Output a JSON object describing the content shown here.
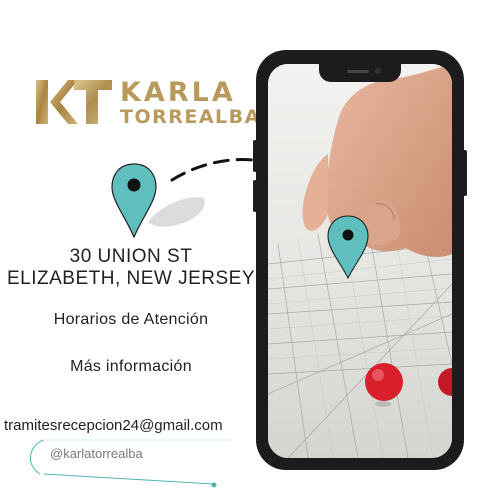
{
  "brand": {
    "line1": "KARLA",
    "line2": "TORREALBA",
    "monogram": "KT-monogram",
    "color": "#b89a5c"
  },
  "address": {
    "line1": "30 UNION ST",
    "line2": "ELIZABETH, NEW JERSEY"
  },
  "links": {
    "hours": "Horarios de Atención",
    "more_info": "Más información"
  },
  "contact": {
    "email": "tramitesrecepcion24@gmail.com",
    "social": "@karlatorrealba"
  },
  "colors": {
    "pin": "#5fbfbe",
    "pin_dot": "#111111",
    "phone": "#1c1c1c",
    "accent_line": "#4fb6b0",
    "push_pin": "#d7202c"
  },
  "icons": [
    "location-pin-icon",
    "map-location-pin-icon",
    "phone-frame",
    "instagram-icon"
  ]
}
